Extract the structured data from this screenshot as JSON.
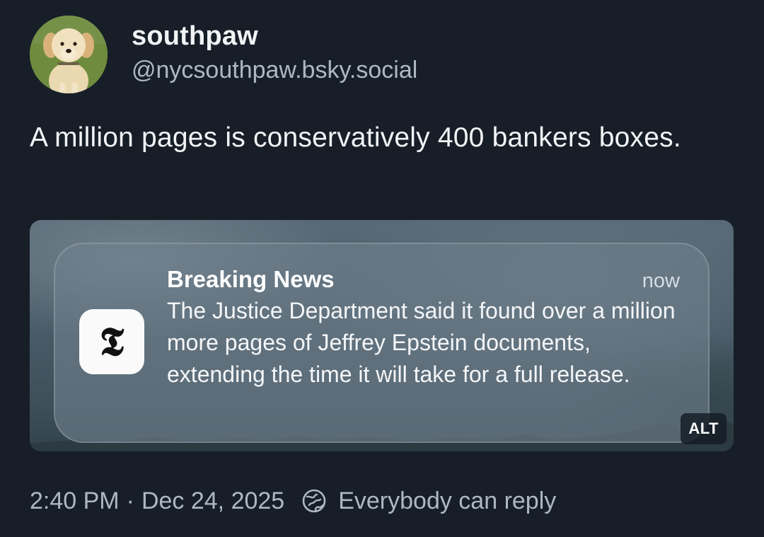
{
  "author": {
    "display_name": "southpaw",
    "handle": "@nycsouthpaw.bsky.social",
    "avatar_icon": "golden-retriever-puppy-avatar"
  },
  "post": {
    "text": "A million pages is conservatively 400 bankers boxes."
  },
  "embed": {
    "notification": {
      "app_icon": "nyt-t-logo",
      "title": "Breaking News",
      "time": "now",
      "body": "The Justice Department said it found over a million more pages of Jeffrey Epstein documents, extending the time it will take for a full release."
    },
    "alt_badge": "ALT"
  },
  "footer": {
    "time": "2:40 PM",
    "separator": "·",
    "date": "Dec 24, 2025",
    "reply_icon": "earth-globe-icon",
    "reply_setting": "Everybody can reply"
  }
}
